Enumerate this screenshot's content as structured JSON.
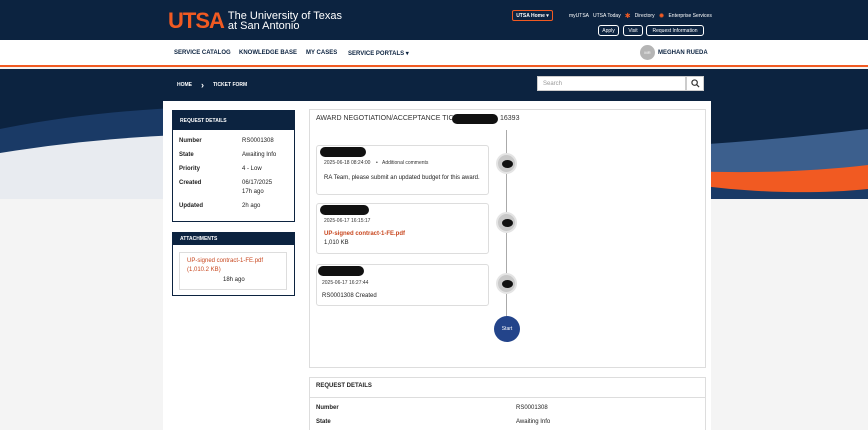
{
  "header": {
    "logo_mark": "UTSA",
    "logo_line1": "The University of Texas",
    "logo_line2": "at San Antonio",
    "utsa_home": "UTSA Home ▾",
    "links": [
      "myUTSA",
      "UTSA Today",
      "Directory",
      "Enterprise Services"
    ],
    "buttons": [
      "Apply",
      "Visit",
      "Request Information"
    ]
  },
  "nav": {
    "items": [
      "SERVICE CATALOG",
      "KNOWLEDGE BASE",
      "MY CASES",
      "SERVICE PORTALS ▾"
    ],
    "avatar_initials": "MR",
    "user_name": "MEGHAN RUEDA"
  },
  "breadcrumb": {
    "home": "HOME",
    "current": "TICKET FORM"
  },
  "search": {
    "placeholder": "Search"
  },
  "request_details": {
    "title": "REQUEST DETAILS",
    "number_label": "Number",
    "number": "RS0001308",
    "state_label": "State",
    "state": "Awaiting Info",
    "priority_label": "Priority",
    "priority": "4 - Low",
    "created_label": "Created",
    "created_date": "06/17/2025",
    "created_ago": "17h ago",
    "updated_label": "Updated",
    "updated": "2h ago"
  },
  "attachments": {
    "title": "ATTACHMENTS",
    "file_name": "UP-signed contract-1-FE.pdf",
    "file_size": "(1,010.2 KB)",
    "age": "18h ago"
  },
  "ticket": {
    "title_prefix": "AWARD NEGOTIATION/ACCEPTANCE TICKET",
    "title_suffix": "16393"
  },
  "timeline": [
    {
      "timestamp": "2025-06-18 08:24:00",
      "tag": "Additional comments",
      "text": "RA Team, please submit an updated budget for this award."
    },
    {
      "timestamp": "2025-06-17 16:15:17",
      "link": "UP-signed contract-1-FE.pdf",
      "size": "1,010 KB"
    },
    {
      "timestamp": "2025-06-17 16:27:44",
      "text": "RS0001308 Created"
    }
  ],
  "start_label": "Start",
  "bottom_details": {
    "title": "REQUEST DETAILS",
    "number_label": "Number",
    "number": "RS0001308",
    "state_label": "State",
    "state": "Awaiting Info"
  },
  "colors": {
    "navy": "#0c2340",
    "orange": "#f15a22",
    "start_blue": "#23448a"
  }
}
